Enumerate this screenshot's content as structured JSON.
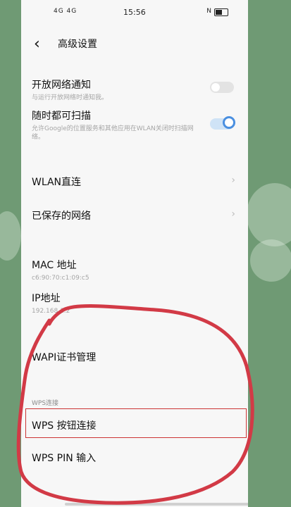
{
  "status_bar": {
    "signal": "4G 4G",
    "time": "15:56",
    "nfc": "N"
  },
  "header": {
    "title": "高级设置"
  },
  "items": {
    "open_network_notify": {
      "label": "开放网络通知",
      "desc": "与运行开放网络时通知我。",
      "toggle": false
    },
    "always_scan": {
      "label": "随时都可扫描",
      "desc": "允许Google的位置服务和其他应用在WLAN关闭时扫描网络。",
      "toggle": true
    },
    "wlan_direct": {
      "label": "WLAN直连"
    },
    "saved_networks": {
      "label": "已保存的网络"
    },
    "mac": {
      "label": "MAC 地址",
      "value": "c6:90:70:c1:09:c5"
    },
    "ip": {
      "label": "IP地址",
      "value": "192.168.1.2"
    },
    "wapi": {
      "label": "WAPI证书管理"
    },
    "wps_section": "WPS连接",
    "wps_button": {
      "label": "WPS 按钮连接"
    },
    "wps_pin": {
      "label": "WPS PIN 输入"
    }
  },
  "colors": {
    "accent": "#4a8fe0",
    "annotation": "#cc3333",
    "background": "#6f9a74"
  }
}
